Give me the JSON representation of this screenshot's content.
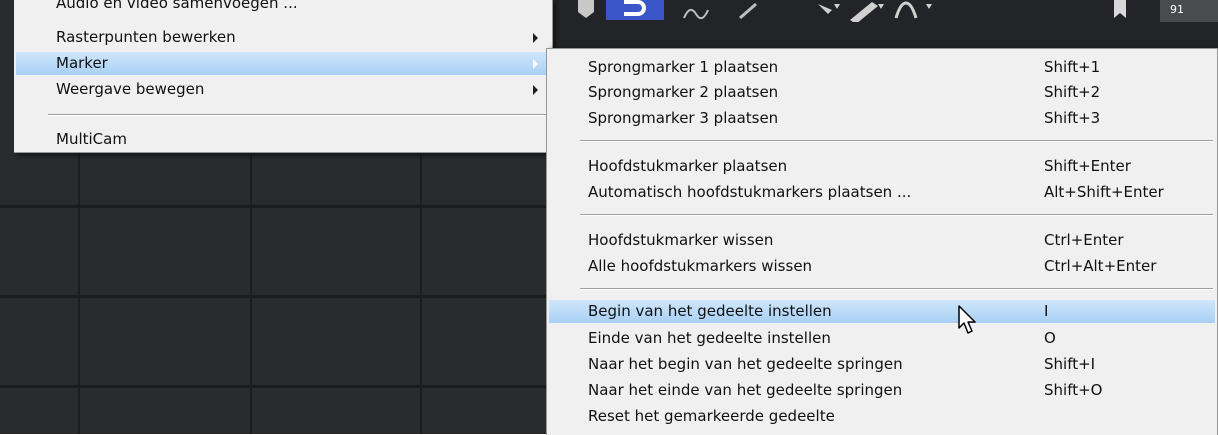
{
  "main_menu": {
    "items": [
      {
        "label": "Audio en video samenvoegen ..."
      },
      {
        "label": "Rasterpunten bewerken"
      },
      {
        "label": "Marker"
      },
      {
        "label": "Weergave bewegen"
      },
      {
        "label": "MultiCam"
      }
    ]
  },
  "submenu": {
    "items": [
      {
        "label": "Sprongmarker 1 plaatsen",
        "shortcut": "Shift+1"
      },
      {
        "label": "Sprongmarker 2 plaatsen",
        "shortcut": "Shift+2"
      },
      {
        "label": "Sprongmarker 3 plaatsen",
        "shortcut": "Shift+3"
      },
      {
        "label": "Hoofdstukmarker plaatsen",
        "shortcut": "Shift+Enter"
      },
      {
        "label": "Automatisch hoofdstukmarkers plaatsen ...",
        "shortcut": "Alt+Shift+Enter"
      },
      {
        "label": "Hoofdstukmarker wissen",
        "shortcut": "Ctrl+Enter"
      },
      {
        "label": "Alle hoofdstukmarkers wissen",
        "shortcut": "Ctrl+Alt+Enter"
      },
      {
        "label": "Begin van het gedeelte instellen",
        "shortcut": "I"
      },
      {
        "label": "Einde van het gedeelte instellen",
        "shortcut": "O"
      },
      {
        "label": "Naar het begin van het gedeelte springen",
        "shortcut": "Shift+I"
      },
      {
        "label": "Naar het einde van het gedeelte springen",
        "shortcut": "Shift+O"
      },
      {
        "label": "Reset het gemarkeerde gedeelte",
        "shortcut": ""
      }
    ]
  },
  "toolbar": {
    "icons": [
      "marker-icon",
      "link-mode-icon",
      "unlink-icon",
      "link-icon",
      "mouse-mode-icon",
      "pencil-icon",
      "curve-icon",
      "bookmark-icon",
      "track-label-icon"
    ],
    "track_label": "91"
  },
  "colors": {
    "highlight_top": "#cfe6fb",
    "highlight_bottom": "#a8d0f4",
    "menu_bg": "#f0f0f0",
    "toolbar_active": "#3a56c8"
  }
}
